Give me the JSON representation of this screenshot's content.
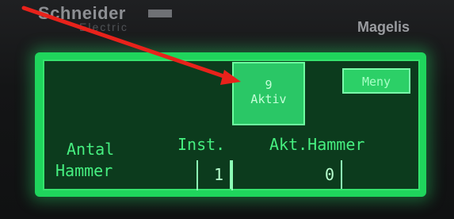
{
  "brand": {
    "name": "Schneider",
    "sub": "Electric",
    "model": "Magelis"
  },
  "screen": {
    "active_count": "9",
    "active_label": "Aktiv",
    "menu_label": "Meny",
    "antal_label": "Antal",
    "hammer_label": "Hammer",
    "inst_label": "Inst.",
    "akt_label": "Akt.Hammer",
    "inst_value": "1",
    "akt_value": "0"
  },
  "colors": {
    "lcd_bg": "#0c3b1d",
    "lcd_glow": "#1fd55c",
    "lcd_text": "#46ef80",
    "arrow": "#e8221b"
  }
}
